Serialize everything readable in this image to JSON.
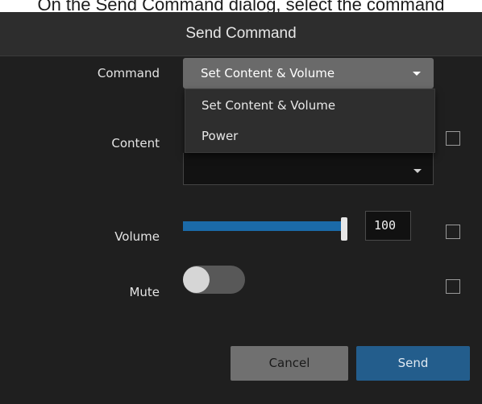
{
  "caption": "On the Send Command dialog, select the command",
  "dialog": {
    "title": "Send Command",
    "command": {
      "label": "Command",
      "selected": "Set Content & Volume",
      "options": [
        "Set Content & Volume",
        "Power"
      ]
    },
    "content": {
      "label": "Content",
      "value": ""
    },
    "volume": {
      "label": "Volume",
      "level_percent": 100,
      "value": "100"
    },
    "mute": {
      "label": "Mute",
      "on": false
    },
    "buttons": {
      "cancel": "Cancel",
      "send": "Send"
    }
  },
  "colors": {
    "dialog_bg": "#1f1f1f",
    "header_bg": "#2d2d2d",
    "slider_fill": "#1b6aa8",
    "send_button": "#235d8c",
    "cancel_button": "#707070"
  },
  "icons": {
    "dropdown_caret": "caret-down-icon"
  }
}
